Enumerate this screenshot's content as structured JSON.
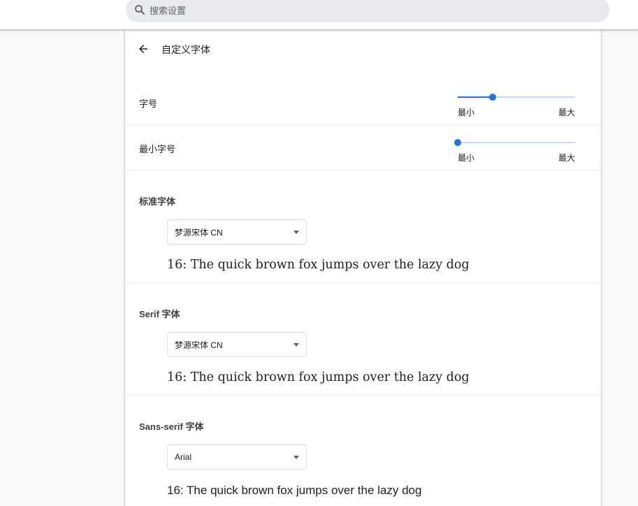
{
  "search": {
    "placeholder": "搜索设置",
    "icon": "search-icon"
  },
  "header": {
    "title": "自定义字体",
    "back_icon": "arrow-back-icon"
  },
  "font_size": {
    "label": "字号",
    "min_label": "最小",
    "max_label": "最大",
    "value": 0.3
  },
  "min_font_size": {
    "label": "最小字号",
    "min_label": "最小",
    "max_label": "最大",
    "value": 0.0
  },
  "standard_font": {
    "title": "标准字体",
    "selected": "梦源宋体 CN",
    "sample": "16: The quick brown fox jumps over the lazy dog"
  },
  "serif_font": {
    "title": "Serif 字体",
    "selected": "梦源宋体 CN",
    "sample": "16: The quick brown fox jumps over the lazy dog"
  },
  "sans_font": {
    "title": "Sans-serif 字体",
    "selected": "Arial",
    "sample": "16: The quick brown fox jumps over the lazy dog"
  },
  "colors": {
    "accent": "#1a73e8",
    "track": "#c6dafc"
  }
}
